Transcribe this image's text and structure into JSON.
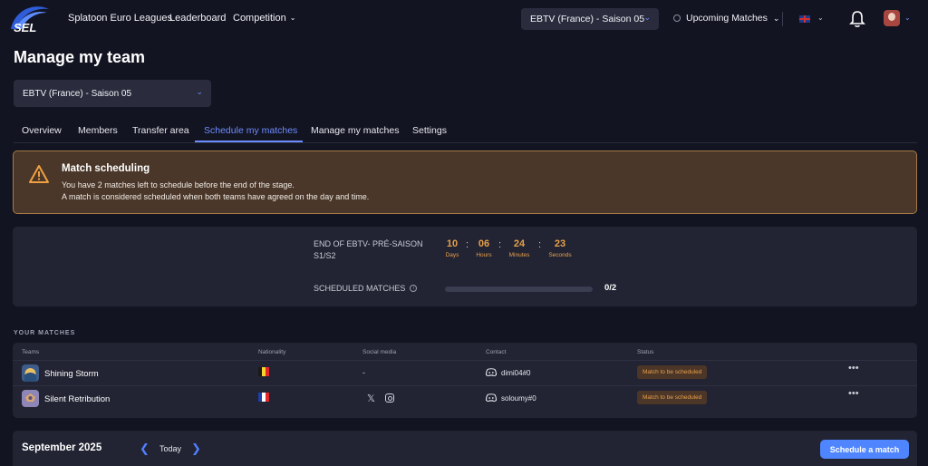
{
  "nav": {
    "links": [
      "Splatoon Euro Leagues",
      "Leaderboard",
      "Competition"
    ],
    "season_select": "EBTV (France) - Saison 05",
    "upcoming": "Upcoming Matches",
    "language": "uk-flag",
    "icons": [
      "logo",
      "bell-icon",
      "avatar",
      "chevron-down-icon"
    ]
  },
  "page": {
    "title": "Manage my team",
    "team_select": "EBTV (France) - Saison 05"
  },
  "tabs": [
    {
      "label": "Overview"
    },
    {
      "label": "Members"
    },
    {
      "label": "Transfer area"
    },
    {
      "label": "Schedule my matches",
      "active": true
    },
    {
      "label": "Manage my matches"
    },
    {
      "label": "Settings"
    }
  ],
  "alert": {
    "title": "Match scheduling",
    "line1": "You have 2 matches left to schedule before the end of the stage.",
    "line2": "A match is considered scheduled when both teams have agreed on the day and time.",
    "accent": "#a57a45"
  },
  "countdown": {
    "label": "END OF EBTV- PRÉ-SAISON S1/S2",
    "days": "10",
    "days_label": "Days",
    "hours": "06",
    "hours_label": "Hours",
    "minutes": "24",
    "minutes_label": "Minutes",
    "seconds": "23",
    "seconds_label": "Seconds",
    "scheduled_label": "SCHEDULED MATCHES",
    "scheduled_value": "0/2",
    "scheduled_fraction": 0,
    "accent": "#e8a04a"
  },
  "matches": {
    "section_title": "YOUR MATCHES",
    "headers": {
      "teams": "Teams",
      "nationality": "Nationality",
      "social": "Social media",
      "contact": "Contact",
      "status": "Status"
    },
    "rows": [
      {
        "team": "Shining Storm",
        "nationality": "Belgium",
        "social": "-",
        "contact": "dimi04#0",
        "status": "Match to be scheduled",
        "more": "•••"
      },
      {
        "team": "Silent Retribution",
        "nationality": "France",
        "social_icons": [
          "x-icon",
          "instagram-icon"
        ],
        "contact": "soloumy#0",
        "status": "Match to be scheduled",
        "more": "•••"
      }
    ]
  },
  "calendar": {
    "month": "September 2025",
    "prev": "❮",
    "today": "Today",
    "next": "❯",
    "schedule_button": "Schedule a match",
    "button_color": "#4f86ff"
  }
}
